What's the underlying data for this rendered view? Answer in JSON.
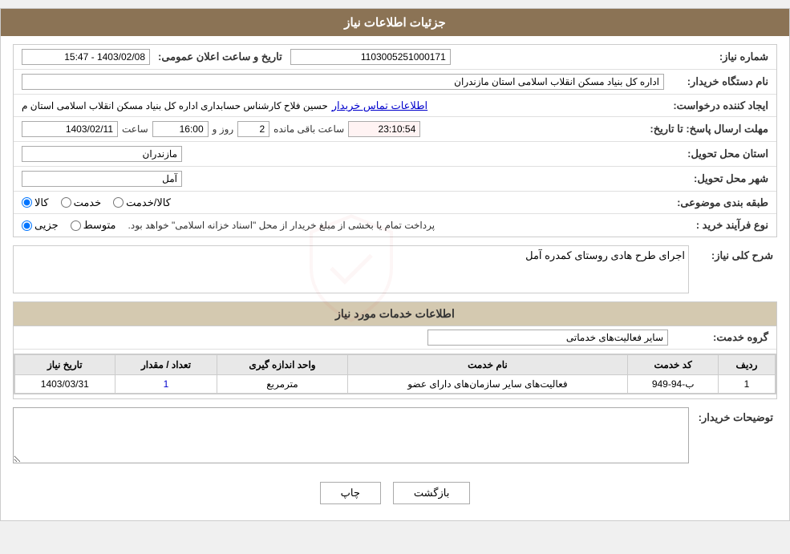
{
  "page": {
    "title": "جزئیات اطلاعات نیاز"
  },
  "header": {
    "title": "جزئیات اطلاعات نیاز"
  },
  "form": {
    "need_number_label": "شماره نیاز:",
    "need_number_value": "1103005251000171",
    "buyer_org_label": "نام دستگاه خریدار:",
    "buyer_org_value": "اداره کل بنیاد مسکن انقلاب اسلامی استان مازندران",
    "date_label": "تاریخ و ساعت اعلان عمومی:",
    "date_value": "1403/02/08 - 15:47",
    "creator_label": "ایجاد کننده درخواست:",
    "creator_value": "حسین فلاح کارشناس حسابداری اداره کل بنیاد مسکن انقلاب اسلامی استان م",
    "contact_link": "اطلاعات تماس خریدار",
    "deadline_label": "مهلت ارسال پاسخ: تا تاریخ:",
    "deadline_date": "1403/02/11",
    "deadline_time_label": "ساعت",
    "deadline_time": "16:00",
    "deadline_day_label": "روز و",
    "deadline_day": "2",
    "deadline_remain_label": "ساعت باقی مانده",
    "deadline_remain": "23:10:54",
    "province_label": "استان محل تحویل:",
    "province_value": "مازندران",
    "city_label": "شهر محل تحویل:",
    "city_value": "آمل",
    "category_label": "طبقه بندی موضوعی:",
    "category_options": [
      {
        "label": "کالا",
        "value": "kala"
      },
      {
        "label": "خدمت",
        "value": "khedmat"
      },
      {
        "label": "کالا/خدمت",
        "value": "kala_khedmat"
      }
    ],
    "category_selected": "kala",
    "purchase_type_label": "نوع فرآیند خرید :",
    "purchase_type_options": [
      {
        "label": "جزیی",
        "value": "jozi"
      },
      {
        "label": "متوسط",
        "value": "motavaset"
      }
    ],
    "purchase_type_selected": "jozi",
    "purchase_type_note": "پرداخت تمام یا بخشی از مبلغ خریدار از محل \"اسناد خزانه اسلامی\" خواهد بود.",
    "description_label": "شرح کلی نیاز:",
    "description_value": "اجرای طرح هادی روستای کمدره آمل"
  },
  "services_section": {
    "title": "اطلاعات خدمات مورد نیاز",
    "group_label": "گروه خدمت:",
    "group_value": "سایر فعالیت‌های خدماتی"
  },
  "table": {
    "columns": [
      "ردیف",
      "کد خدمت",
      "نام خدمت",
      "واحد اندازه گیری",
      "تعداد / مقدار",
      "تاریخ نیاز"
    ],
    "rows": [
      {
        "row": "1",
        "code": "ب-94-949",
        "name": "فعالیت‌های سایر سازمان‌های دارای عضو",
        "unit": "مترمربع",
        "count": "1",
        "date": "1403/03/31"
      }
    ]
  },
  "buyer_notes_label": "توضیحات خریدار:",
  "buyer_notes_value": "",
  "buttons": {
    "print": "چاپ",
    "back": "بازگشت"
  }
}
